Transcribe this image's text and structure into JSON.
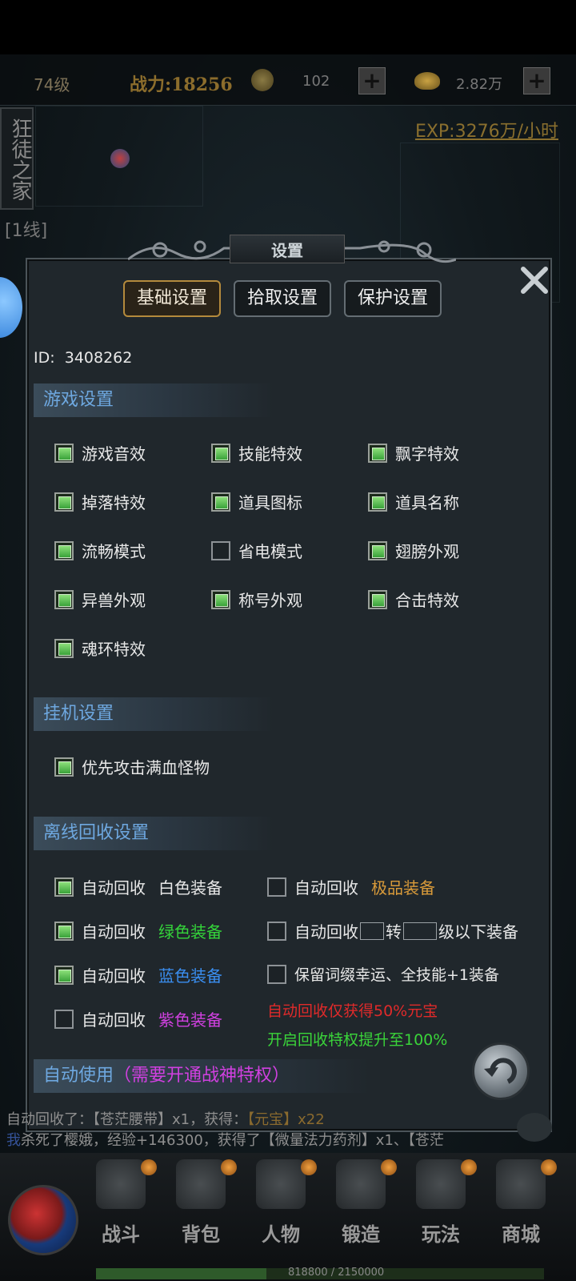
{
  "hud": {
    "level": "74级",
    "power": "战力:18256",
    "currency1": "102",
    "currency2": "2.82万",
    "plus_label": "+"
  },
  "sidebar": {
    "guild_tag": "狂徒之家",
    "exp": "EXP:3276万/小时",
    "line": "[1线]"
  },
  "dialog": {
    "title": "设置",
    "tabs": [
      "基础设置",
      "拾取设置",
      "保护设置"
    ],
    "active_tab": 0,
    "id_label": "ID:",
    "id_value": "3408262",
    "sections": {
      "game": "游戏设置",
      "afk": "挂机设置",
      "offline": "离线回收设置",
      "auto_use": "自动使用",
      "auto_use_note": "（需要开通战神特权）"
    },
    "game_options": [
      {
        "label": "游戏音效",
        "checked": true
      },
      {
        "label": "技能特效",
        "checked": true
      },
      {
        "label": "飘字特效",
        "checked": true
      },
      {
        "label": "掉落特效",
        "checked": true
      },
      {
        "label": "道具图标",
        "checked": true
      },
      {
        "label": "道具名称",
        "checked": true
      },
      {
        "label": "流畅模式",
        "checked": true
      },
      {
        "label": "省电模式",
        "checked": false
      },
      {
        "label": "翅膀外观",
        "checked": true
      },
      {
        "label": "异兽外观",
        "checked": true
      },
      {
        "label": "称号外观",
        "checked": true
      },
      {
        "label": "合击特效",
        "checked": true
      },
      {
        "label": "魂环特效",
        "checked": true
      }
    ],
    "afk_options": [
      {
        "label": "优先攻击满血怪物",
        "checked": true
      }
    ],
    "recycle": {
      "auto_label": "自动回收",
      "left": [
        {
          "quality": "白色装备",
          "color": "#e8e8e8",
          "checked": true
        },
        {
          "quality": "绿色装备",
          "color": "#34d43a",
          "checked": true
        },
        {
          "quality": "蓝色装备",
          "color": "#3a8ef0",
          "checked": true
        },
        {
          "quality": "紫色装备",
          "color": "#d040e0",
          "checked": false
        }
      ],
      "right_top": {
        "quality": "极品装备",
        "color": "#d89a3a",
        "checked": false
      },
      "right_mid": {
        "turn_label": "转",
        "level_suffix": "级以下装备",
        "checked": false
      },
      "right_bot": {
        "label": "保留词缀幸运、全技能+1装备",
        "checked": false
      },
      "note_red": "自动回收仅获得50%元宝",
      "note_green": "开启回收特权提升至100%"
    }
  },
  "chat": {
    "line1_a": "自动回收了：",
    "line1_b": "【苍茫腰带】x1，获得：",
    "line1_c": "【元宝】x22",
    "line2_a": "我",
    "line2_b": "杀死了樱娥，经验+146300，获得了【微量法力药剂】x1、【苍茫"
  },
  "bottom_nav": [
    {
      "label": "战斗"
    },
    {
      "label": "背包"
    },
    {
      "label": "人物"
    },
    {
      "label": "锻造"
    },
    {
      "label": "玩法"
    },
    {
      "label": "商城"
    }
  ],
  "hp_text": "818800 / 2150000",
  "hp_fraction": 0.381,
  "colors": {
    "accent_gold": "#b48a3c",
    "section_blue": "#6ea8e0",
    "note_red": "#e02a2a",
    "note_green": "#3ad43a",
    "auto_use_purple": "#d040e0"
  }
}
